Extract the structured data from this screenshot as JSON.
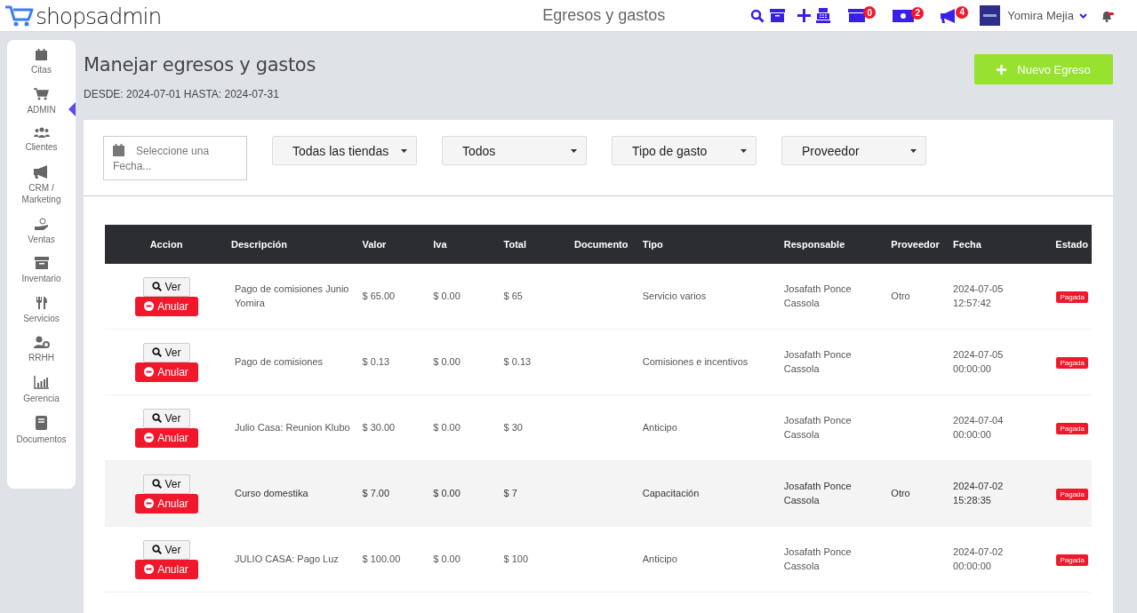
{
  "header": {
    "logo": "shopsadmin",
    "title": "Egresos y gastos",
    "badges": [
      {
        "kind": "box",
        "count": "0"
      },
      {
        "kind": "money",
        "count": "2"
      },
      {
        "kind": "megaphone",
        "count": "4"
      }
    ],
    "user": "Yomira Mejia"
  },
  "sidebar": {
    "items": [
      {
        "label": "Citas",
        "selected": false
      },
      {
        "label": "ADMIN",
        "selected": true
      },
      {
        "label": "Clientes",
        "selected": false
      },
      {
        "label": "CRM / Marketing",
        "selected": false
      },
      {
        "label": "Ventas",
        "selected": false
      },
      {
        "label": "Inventario",
        "selected": false
      },
      {
        "label": "Servicios",
        "selected": false
      },
      {
        "label": "RRHH",
        "selected": false
      },
      {
        "label": "Gerencia",
        "selected": false
      },
      {
        "label": "Documentos",
        "selected": false
      }
    ]
  },
  "page": {
    "title": "Manejar egresos y gastos",
    "range": "DESDE: 2024-07-01 HASTA: 2024-07-31",
    "new_button": "Nuevo Egreso"
  },
  "filters": {
    "date": {
      "placeholder": "Seleccione una Fecha..."
    },
    "dropdowns": [
      "Todas las tiendas",
      "Todos",
      "Tipo de gasto",
      "Proveedor"
    ]
  },
  "table": {
    "columns": [
      "Accion",
      "Descripción",
      "Valor",
      "Iva",
      "Total",
      "Documento",
      "Tipo",
      "Responsable",
      "Proveedor",
      "Fecha",
      "Estado"
    ],
    "rows": [
      {
        "view_label": "Ver",
        "void_label": "Anular",
        "description": "Pago de comisiones Junio Yomira",
        "valor": "$ 65.00",
        "iva": "$ 0.00",
        "total": "$ 65",
        "documento": "",
        "tipo": "Servicio varios",
        "responsable": "Josafath Ponce Cassola",
        "proveedor": "Otro",
        "fecha": "2024-07-05 12:57:42",
        "estado": "Pagada",
        "selected": false
      },
      {
        "view_label": "Ver",
        "void_label": "Anular",
        "description": "Pago de comisiones",
        "valor": "$ 0.13",
        "iva": "$ 0.00",
        "total": "$ 0.13",
        "documento": "",
        "tipo": "Comisiones e incentivos",
        "responsable": "Josafath Ponce Cassola",
        "proveedor": "",
        "fecha": "2024-07-05 00:00:00",
        "estado": "Pagada",
        "selected": false
      },
      {
        "view_label": "Ver",
        "void_label": "Anular",
        "description": "Julio Casa: Reunion Klubo",
        "valor": "$ 30.00",
        "iva": "$ 0.00",
        "total": "$ 30",
        "documento": "",
        "tipo": "Anticipo",
        "responsable": "Josafath Ponce Cassola",
        "proveedor": "",
        "fecha": "2024-07-04 00:00:00",
        "estado": "Pagada",
        "selected": false
      },
      {
        "view_label": "Ver",
        "void_label": "Anular",
        "description": "Curso domestika",
        "valor": "$ 7.00",
        "iva": "$ 0.00",
        "total": "$ 7",
        "documento": "",
        "tipo": "Capacitación",
        "responsable": "Josafath Ponce Cassola",
        "proveedor": "Otro",
        "fecha": "2024-07-02 15:28:35",
        "estado": "Pagada",
        "selected": true
      },
      {
        "view_label": "Ver",
        "void_label": "Anular",
        "description": "JULIO CASA: Pago Luz",
        "valor": "$ 100.00",
        "iva": "$ 0.00",
        "total": "$ 100",
        "documento": "",
        "tipo": "Anticipo",
        "responsable": "Josafath Ponce Cassola",
        "proveedor": "",
        "fecha": "2024-07-02 00:00:00",
        "estado": "Pagada",
        "selected": false
      }
    ]
  }
}
